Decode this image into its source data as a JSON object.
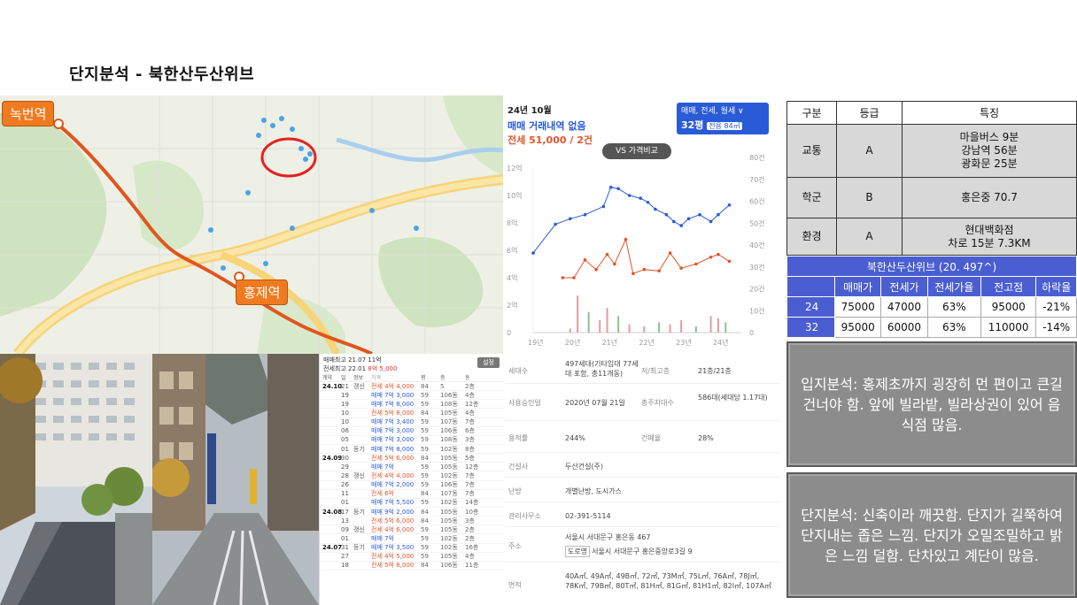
{
  "title": "단지분석 -   북한산두산위브",
  "map": {
    "stations": [
      {
        "name": "녹번역",
        "icon": "subway-station-icon"
      },
      {
        "name": "홍제역",
        "icon": "subway-station-icon"
      }
    ],
    "target_marker_icon": "red-circle-icon"
  },
  "price_chart": {
    "period": "24년 10월",
    "sale_text": "매매 거래내역 없음",
    "jeonse_text": "전세 51,000 / 2건",
    "deal_selector": "매매, 전세, 월세 ∨",
    "size_label": "32평",
    "size_detail": "전용 84㎡",
    "compare_button": "VS 가격비교"
  },
  "chart_data": {
    "type": "line",
    "x": [
      "19년",
      "20년",
      "21년",
      "22년",
      "23년",
      "24년"
    ],
    "y_left_ticks": [
      "12억",
      "10억",
      "8억",
      "6억",
      "4억",
      "2억",
      "0"
    ],
    "y_right_ticks": [
      "80건",
      "70건",
      "60건",
      "50건",
      "40건",
      "30건",
      "20건",
      "10건",
      "0"
    ],
    "y_left_range": [
      0,
      12
    ],
    "y_right_range": [
      0,
      80
    ],
    "series": [
      {
        "name": "매매",
        "color": "#2a5bd7",
        "points": [
          [
            2019.0,
            5.8
          ],
          [
            2019.6,
            7.9
          ],
          [
            2020.0,
            8.3
          ],
          [
            2020.4,
            8.6
          ],
          [
            2020.9,
            9.2
          ],
          [
            2021.1,
            10.6
          ],
          [
            2021.3,
            10.5
          ],
          [
            2021.6,
            10.0
          ],
          [
            2021.9,
            9.8
          ],
          [
            2022.1,
            9.5
          ],
          [
            2022.3,
            9.0
          ],
          [
            2022.6,
            8.6
          ],
          [
            2022.8,
            8.1
          ],
          [
            2023.0,
            7.8
          ],
          [
            2023.2,
            8.3
          ],
          [
            2023.5,
            8.6
          ],
          [
            2023.8,
            8.1
          ],
          [
            2024.0,
            8.6
          ],
          [
            2024.3,
            9.3
          ]
        ]
      },
      {
        "name": "전세",
        "color": "#e0552b",
        "points": [
          [
            2019.8,
            4.0
          ],
          [
            2020.1,
            4.0
          ],
          [
            2020.4,
            5.3
          ],
          [
            2020.7,
            4.6
          ],
          [
            2021.0,
            5.7
          ],
          [
            2021.2,
            5.0
          ],
          [
            2021.5,
            6.8
          ],
          [
            2021.7,
            4.3
          ],
          [
            2022.0,
            4.6
          ],
          [
            2022.4,
            4.5
          ],
          [
            2022.7,
            5.8
          ],
          [
            2023.0,
            4.7
          ],
          [
            2023.4,
            5.0
          ],
          [
            2023.8,
            5.5
          ],
          [
            2024.0,
            5.7
          ],
          [
            2024.3,
            5.2
          ]
        ]
      }
    ],
    "volume_color": "#e59c9c",
    "volume_color_2": "#8bc48b",
    "volume": [
      [
        2020.0,
        2
      ],
      [
        2020.2,
        18
      ],
      [
        2020.5,
        10
      ],
      [
        2020.8,
        6
      ],
      [
        2021.0,
        12
      ],
      [
        2021.3,
        8
      ],
      [
        2021.6,
        4
      ],
      [
        2022.0,
        3
      ],
      [
        2022.4,
        5
      ],
      [
        2022.7,
        4
      ],
      [
        2023.0,
        6
      ],
      [
        2023.4,
        3
      ],
      [
        2023.8,
        8
      ],
      [
        2024.0,
        7
      ],
      [
        2024.2,
        5
      ]
    ]
  },
  "tx_list": {
    "header_line1": "매매최고 21.07 11억",
    "header_line2a": "전세최고 22.01",
    "header_line2b": "8억 5,000",
    "button": "설정",
    "columns": [
      "계약",
      "일",
      "정보",
      "가격",
      "평",
      "층",
      "동",
      ""
    ],
    "rows": [
      {
        "m": "24.10",
        "d": "21",
        "t": "갱신",
        "kind": "jeonse",
        "p": "전세 4억 4,000",
        "a": "84",
        "b": "5",
        "c": "2층"
      },
      {
        "m": "",
        "d": "19",
        "t": "",
        "kind": "sale",
        "p": "매매 7억 3,000",
        "a": "59",
        "b": "106동",
        "c": "4층"
      },
      {
        "m": "",
        "d": "19",
        "t": "",
        "kind": "sale",
        "p": "매매 7억 8,000",
        "a": "59",
        "b": "108동",
        "c": "12층"
      },
      {
        "m": "",
        "d": "10",
        "t": "",
        "kind": "jeonse",
        "p": "전세 5억 8,000",
        "a": "84",
        "b": "105동",
        "c": "4층"
      },
      {
        "m": "",
        "d": "10",
        "t": "",
        "kind": "sale",
        "p": "매매 7억 3,400",
        "a": "59",
        "b": "107동",
        "c": "7층"
      },
      {
        "m": "",
        "d": "06",
        "t": "",
        "kind": "sale",
        "p": "매매 7억 3,000",
        "a": "59",
        "b": "106동",
        "c": "6층"
      },
      {
        "m": "",
        "d": "05",
        "t": "",
        "kind": "sale",
        "p": "매매 7억 3,000",
        "a": "59",
        "b": "108동",
        "c": "3층"
      },
      {
        "m": "",
        "d": "01",
        "t": "등기",
        "kind": "sale",
        "p": "매매 7억 8,000",
        "a": "59",
        "b": "102동",
        "c": "8층"
      },
      {
        "m": "24.09",
        "d": "30",
        "t": "",
        "kind": "jeonse",
        "p": "전세 5억 6,000",
        "a": "84",
        "b": "105동",
        "c": "5층"
      },
      {
        "m": "",
        "d": "29",
        "t": "",
        "kind": "sale",
        "p": "매매 7억",
        "a": "59",
        "b": "105동",
        "c": "12층"
      },
      {
        "m": "",
        "d": "28",
        "t": "갱신",
        "kind": "jeonse",
        "p": "전세 4억 4,000",
        "a": "59",
        "b": "102동",
        "c": "7층"
      },
      {
        "m": "",
        "d": "26",
        "t": "",
        "kind": "sale",
        "p": "매매 7억 2,000",
        "a": "59",
        "b": "106동",
        "c": "7층"
      },
      {
        "m": "",
        "d": "11",
        "t": "",
        "kind": "jeonse",
        "p": "전세 6억",
        "a": "84",
        "b": "107동",
        "c": "7층"
      },
      {
        "m": "",
        "d": "01",
        "t": "",
        "kind": "sale",
        "p": "매매 7억 5,500",
        "a": "59",
        "b": "102동",
        "c": "14층"
      },
      {
        "m": "24.08",
        "d": "17",
        "t": "등기",
        "kind": "sale",
        "p": "매매 9억 2,000",
        "a": "84",
        "b": "105동",
        "c": "10층"
      },
      {
        "m": "",
        "d": "13",
        "t": "",
        "kind": "jeonse",
        "p": "전세 5억 6,000",
        "a": "84",
        "b": "105동",
        "c": "3층"
      },
      {
        "m": "",
        "d": "09",
        "t": "갱신",
        "kind": "jeonse",
        "p": "전세 4억 6,000",
        "a": "59",
        "b": "105동",
        "c": "2층"
      },
      {
        "m": "",
        "d": "01",
        "t": "",
        "kind": "sale",
        "p": "매매 7억",
        "a": "59",
        "b": "102동",
        "c": "2층"
      },
      {
        "m": "24.07",
        "d": "31",
        "t": "등기",
        "kind": "sale",
        "p": "매매 7억 3,500",
        "a": "59",
        "b": "102동",
        "c": "16층"
      },
      {
        "m": "",
        "d": "27",
        "t": "",
        "kind": "jeonse",
        "p": "전세 4억 5,000",
        "a": "59",
        "b": "105동",
        "c": "4층"
      },
      {
        "m": "",
        "d": "18",
        "t": "",
        "kind": "jeonse",
        "p": "전세 5억 8,000",
        "a": "84",
        "b": "106동",
        "c": "11층"
      }
    ]
  },
  "building_info": {
    "households_label": "세대수",
    "households": "497세대(기타임대 77세대 포함, 총11개동)",
    "floors_label": "저/최고층",
    "floors": "21층/21층",
    "approval_label": "사용승인일",
    "approval": "2020년 07월 21일",
    "parking_label": "총주차대수",
    "parking": "586대(세대당 1.17대)",
    "far_label": "용적률",
    "far": "244%",
    "bcr_label": "건폐율",
    "bcr": "28%",
    "builder_label": "건설사",
    "builder": "두산건설(주)",
    "heating_label": "난방",
    "heating": "개별난방, 도시가스",
    "office_label": "관리사무소",
    "office": "02-391-5114",
    "address_label": "주소",
    "address": "서울시 서대문구 홍은동 467",
    "road_badge": "도로명",
    "road_address": "서울시 서대문구 홍은중앙로3길 9",
    "area_label": "면적",
    "area": "40A㎡, 49A㎡, 49B㎡, 72㎡, 73M㎡, 75L㎡, 76A㎡, 78J㎡, 78K㎡, 79B㎡, 80T㎡, 81H㎡, 81G㎡, 81H1㎡, 82I㎡, 107A㎡"
  },
  "rating_table": {
    "headers": [
      "구분",
      "등급",
      "특징"
    ],
    "rows": [
      {
        "category": "교통",
        "grade": "A",
        "features": [
          "마을버스 9분",
          "강남역 56분",
          "광화문 25분"
        ]
      },
      {
        "category": "학군",
        "grade": "B",
        "features": [
          "홍은중 70.7"
        ]
      },
      {
        "category": "환경",
        "grade": "A",
        "features": [
          "현대백화점",
          "차로 15분 7.3KM"
        ]
      }
    ]
  },
  "price_table": {
    "title": "북한산두산위브 (20. 497^)",
    "headers": [
      "",
      "매매가",
      "전세가",
      "전세가율",
      "전고점",
      "하락율"
    ],
    "rows": [
      [
        "24",
        "75000",
        "47000",
        "63%",
        "95000",
        "-21%"
      ],
      [
        "32",
        "95000",
        "60000",
        "63%",
        "110000",
        "-14%"
      ]
    ]
  },
  "notes": {
    "location": "입지분석: 홍제초까지 굉장히 먼 편이고 큰길건너야 함. 앞에 빌라밭, 빌라상권이 있어 음식점 많음.",
    "complex": "단지분석: 신축이라 깨끗함. 단지가 길쭉하여 단지내는 좁은 느낌. 단지가 오밀조밀하고 밝은 느낌 덜함. 단차있고 계단이 많음."
  }
}
